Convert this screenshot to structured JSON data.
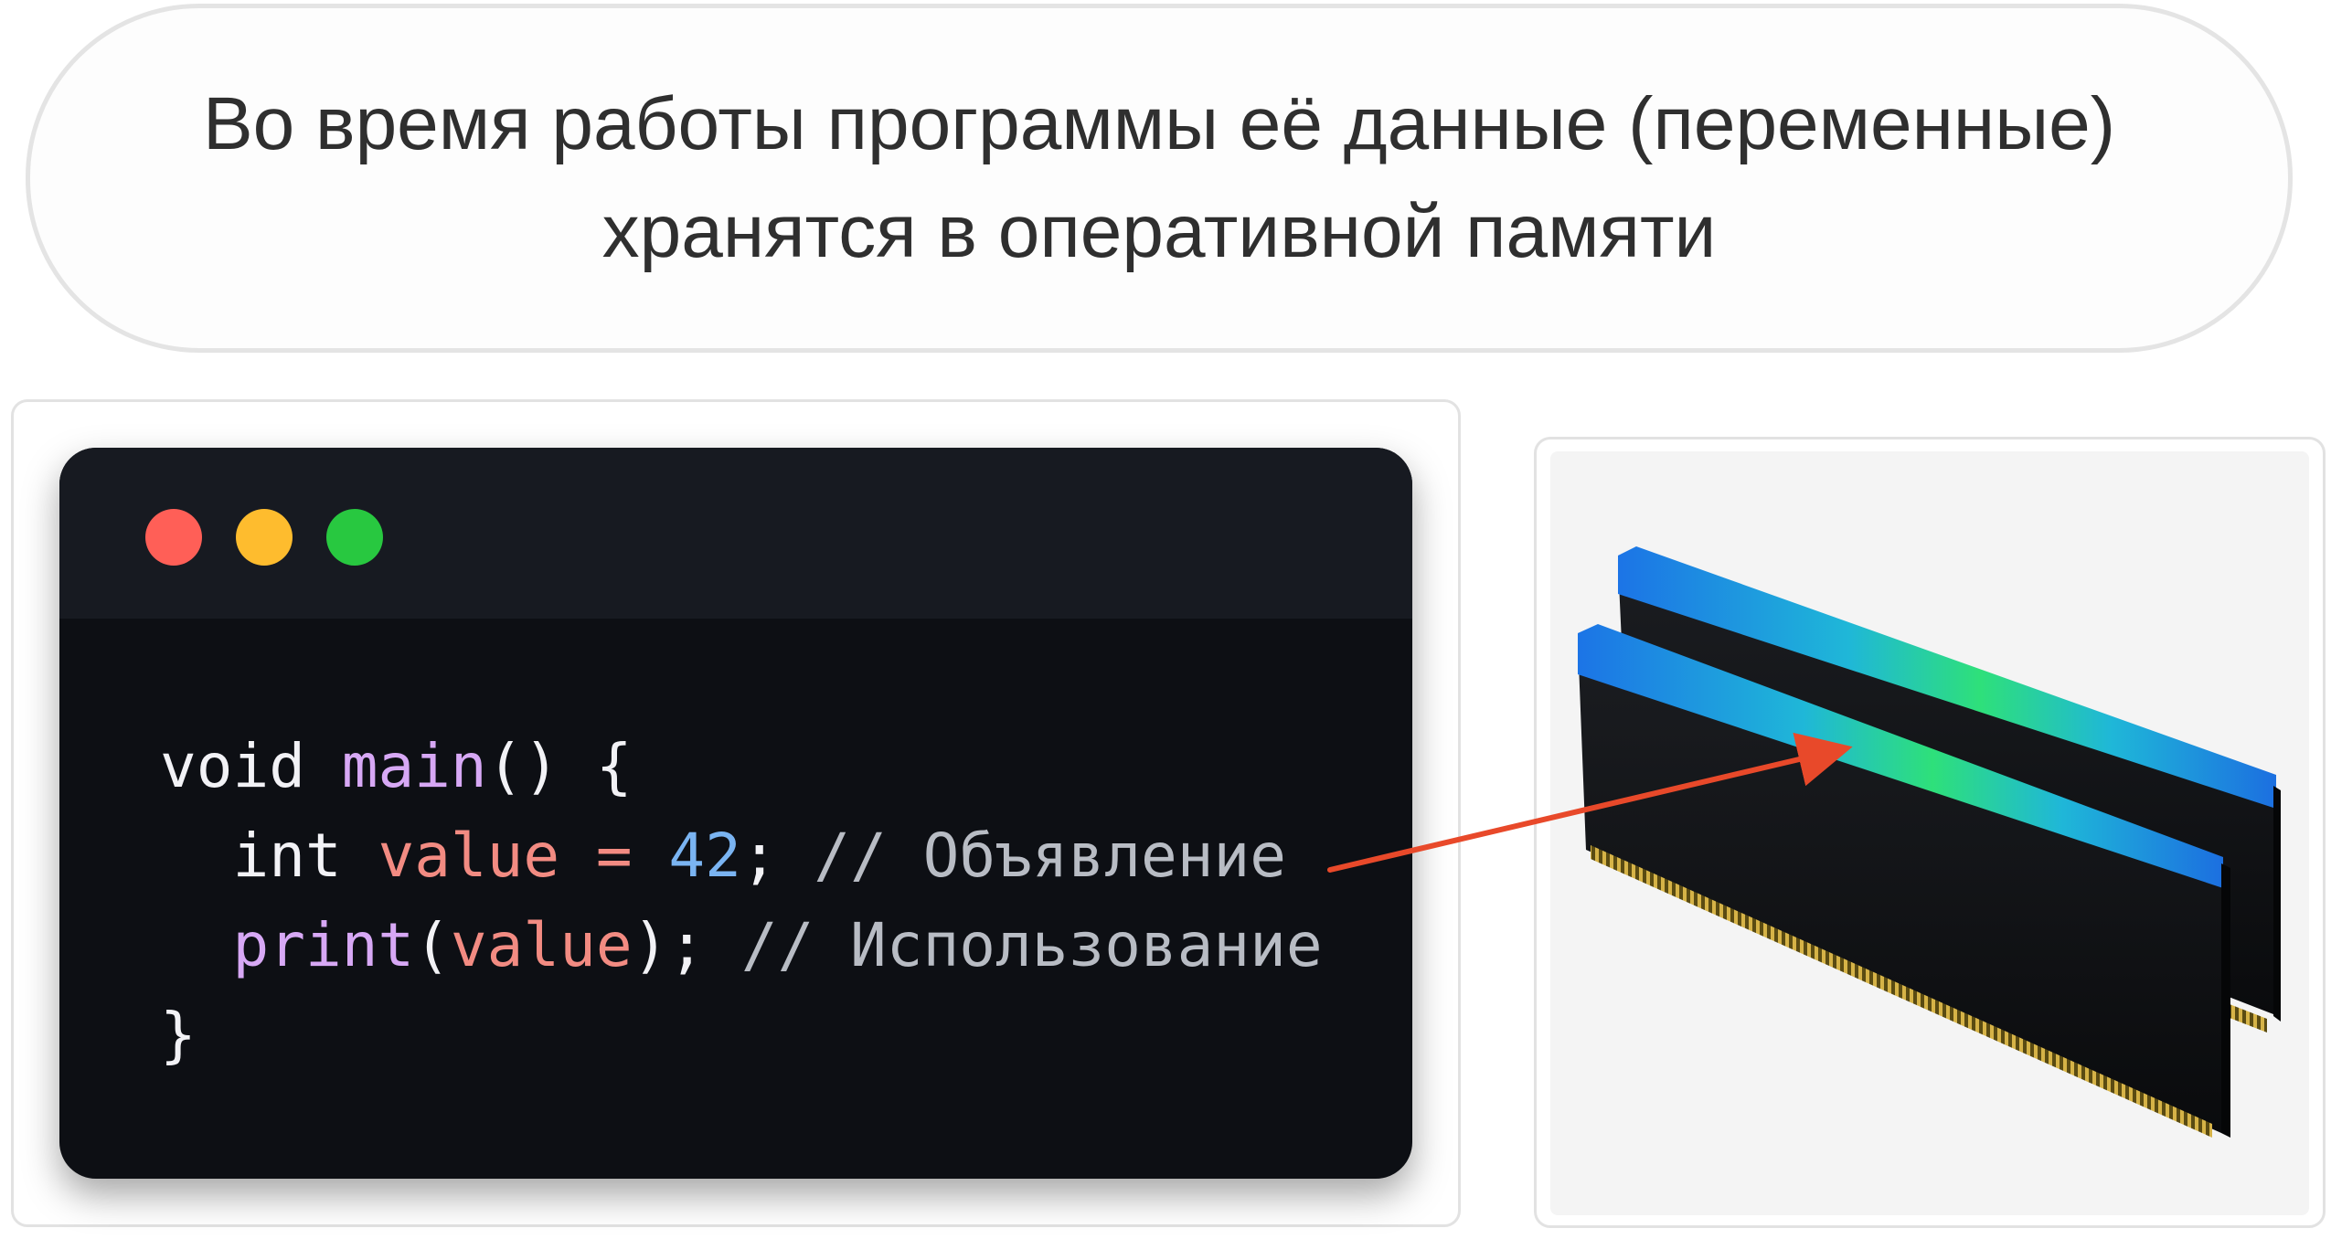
{
  "banner": {
    "line1": "Во время работы программы её данные (переменные)",
    "line2": "хранятся в оперативной памяти"
  },
  "code": {
    "line1": {
      "kw": "void",
      "fn": "main",
      "rest": "() {"
    },
    "line2": {
      "kw": "int",
      "var": "value",
      "op": "=",
      "num": "42",
      "semi": ";",
      "comment": "// Объявление"
    },
    "line3": {
      "fn": "print",
      "open": "(",
      "var": "value",
      "close": ");",
      "comment": "// Использование"
    },
    "line4": {
      "brace": "}"
    }
  },
  "window_controls": [
    "close-dot",
    "minimize-dot",
    "maximize-dot"
  ],
  "colors": {
    "close": "#ff5f57",
    "minimize": "#febc2e",
    "maximize": "#28c840",
    "arrow": "#e8492a",
    "keyword": "#f2f2f6",
    "function": "#d7a8f5",
    "variable": "#f28b82",
    "number": "#7ab4f2",
    "comment": "#b8bcc4"
  },
  "image": {
    "subject": "ram-modules-icon"
  }
}
